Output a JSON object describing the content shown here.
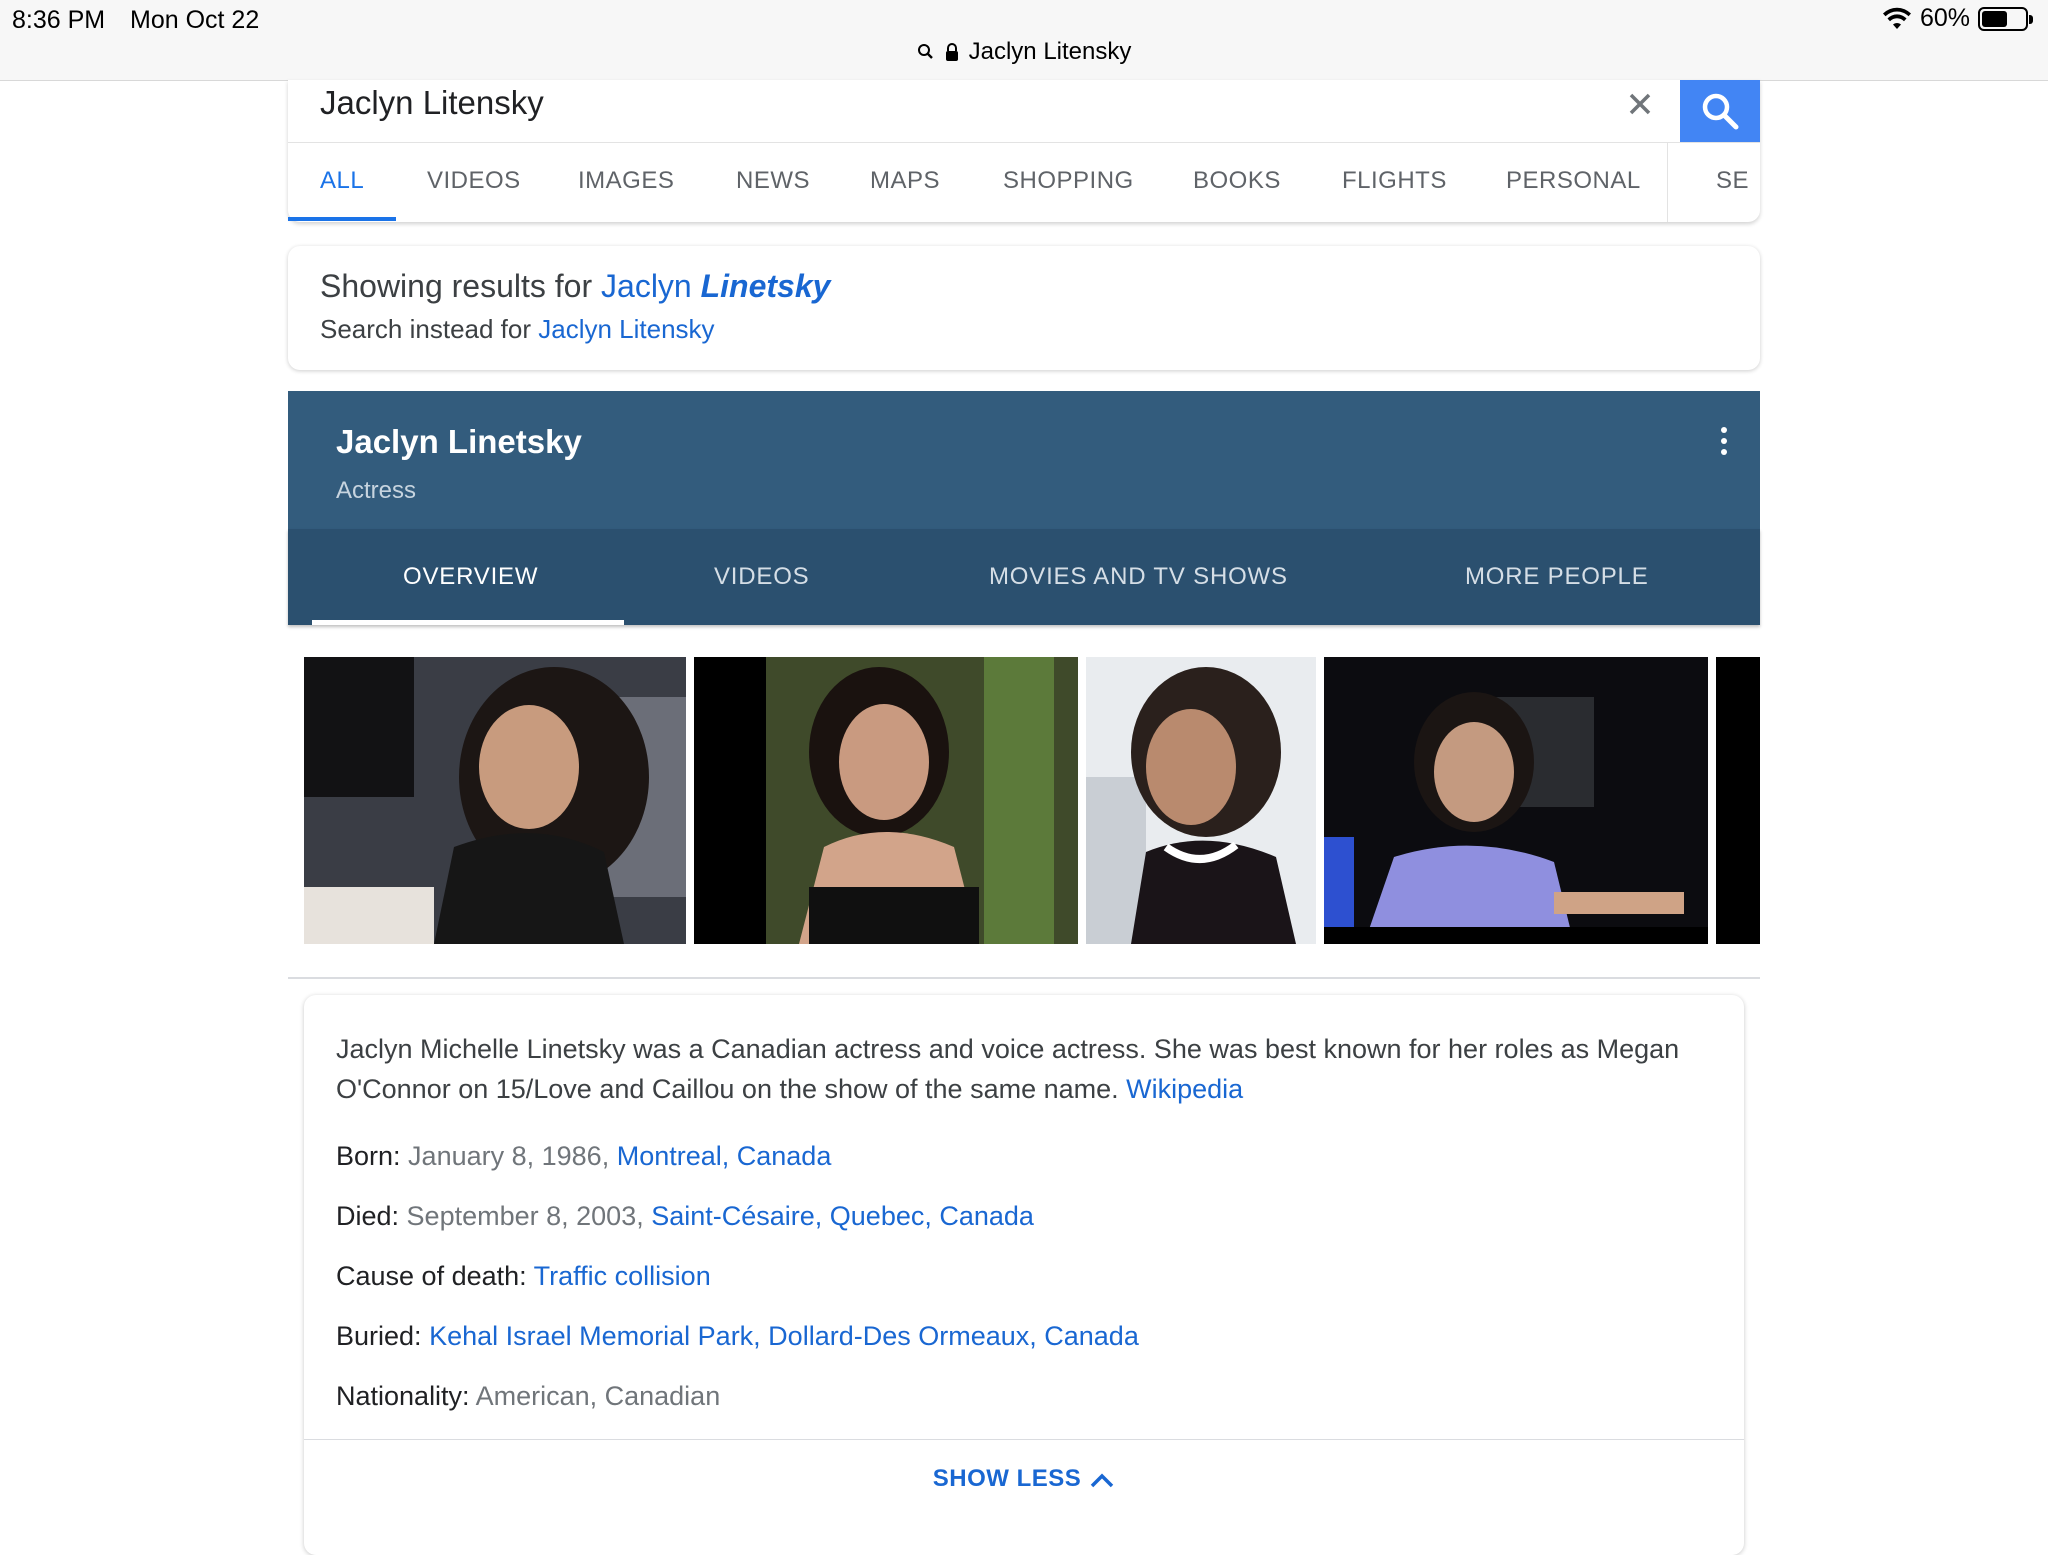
{
  "status": {
    "time": "8:36 PM",
    "date": "Mon Oct 22",
    "battery": "60%",
    "battery_level": 0.6
  },
  "url": {
    "text": "Jaclyn Litensky"
  },
  "search": {
    "query": "Jaclyn Litensky",
    "tabs": [
      {
        "label": "ALL"
      },
      {
        "label": "VIDEOS"
      },
      {
        "label": "IMAGES"
      },
      {
        "label": "NEWS"
      },
      {
        "label": "MAPS"
      },
      {
        "label": "SHOPPING"
      },
      {
        "label": "BOOKS"
      },
      {
        "label": "FLIGHTS"
      },
      {
        "label": "PERSONAL"
      },
      {
        "label": "SE"
      }
    ]
  },
  "correction": {
    "showing_prefix": "Showing results for ",
    "corrected_first": "Jaclyn ",
    "corrected_emph": "Linetsky",
    "instead_prefix": "Search instead for ",
    "original_query": "Jaclyn Litensky"
  },
  "knowledge_panel": {
    "name": "Jaclyn Linetsky",
    "type": "Actress",
    "tabs": [
      {
        "label": "OVERVIEW"
      },
      {
        "label": "VIDEOS"
      },
      {
        "label": "MOVIES AND TV SHOWS"
      },
      {
        "label": "MORE PEOPLE"
      }
    ],
    "description": "Jaclyn Michelle Linetsky was a Canadian actress and voice actress. She was best known for her roles as Megan O'Connor on 15/Love and Caillou on the show of the same name. ",
    "source_link": "Wikipedia",
    "facts": {
      "born": {
        "label": "Born: ",
        "value": "January 8, 1986, ",
        "link": "Montreal, Canada"
      },
      "died": {
        "label": "Died: ",
        "value": "September 8, 2003, ",
        "link": "Saint-Césaire, Quebec, Canada"
      },
      "cause": {
        "label": "Cause of death: ",
        "link": "Traffic collision"
      },
      "buried": {
        "label": "Buried: ",
        "link": "Kehal Israel Memorial Park, Dollard-Des Ormeaux, Canada"
      },
      "nationality": {
        "label": "Nationality: ",
        "value": "American, Canadian"
      }
    },
    "show_less": "SHOW LESS"
  },
  "colors": {
    "accent": "#1a73e8",
    "link": "#1967d2",
    "panel_header": "#335c7d",
    "panel_tabs": "#2b506f",
    "search_button": "#4285f4"
  }
}
